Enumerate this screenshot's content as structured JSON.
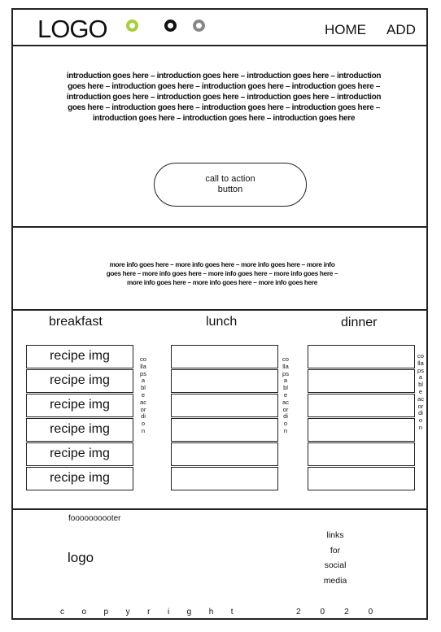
{
  "header": {
    "logo": "LOGO",
    "nav": [
      "HOME",
      "ADD"
    ],
    "circle_colors": [
      "#a6ce39",
      "#111111",
      "#888888"
    ],
    "circle_icons": [
      "circle-icon",
      "circle-icon",
      "circle-icon"
    ]
  },
  "intro": {
    "text": "introduction goes here – introduction goes here – introduction goes here – introduction goes here – introduction goes here – introduction goes here – introduction goes here – introduction goes here – introduction goes here – introduction goes here – introduction goes here – introduction goes here – introduction goes here – introduction goes here – introduction goes here – introduction goes here – introduction goes here",
    "cta_label": "call to action button"
  },
  "more_info": {
    "text": "more info goes here – more info goes here – more info goes here – more info goes here – more info goes here – more info goes here – more info goes here – more info goes here – more info goes here – more info goes here"
  },
  "meals": {
    "titles": [
      "breakfast",
      "lunch",
      "dinner"
    ],
    "recipe_label": "recipe img",
    "accordion_label": "collapsable acordion"
  },
  "footer": {
    "title": "foooooooooter",
    "logo": "logo",
    "links": [
      "links",
      "for",
      "social",
      "media"
    ],
    "copyright_word": "copyright",
    "copyright_year": "2020"
  }
}
